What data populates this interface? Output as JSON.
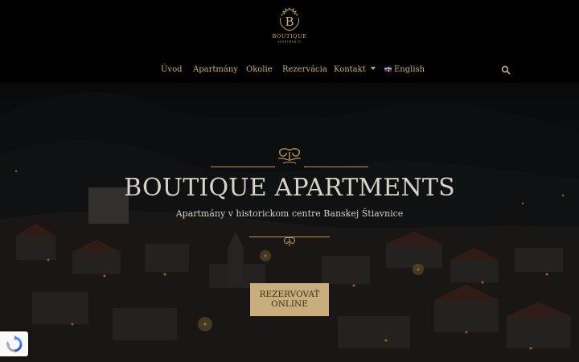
{
  "logo": {
    "letter": "B",
    "name": "BOUTIQUE",
    "tagline": "APARTMENTS"
  },
  "nav": {
    "items": [
      {
        "label": "Úvod"
      },
      {
        "label": "Apartmány"
      },
      {
        "label": "Okolie"
      },
      {
        "label": "Rezervácia"
      },
      {
        "label": "Kontakt",
        "has_dropdown": true
      },
      {
        "label": "English",
        "flag": "uk-flag"
      }
    ],
    "search_icon": "search-icon"
  },
  "hero": {
    "title": "BOUTIQUE APARTMENTS",
    "subtitle": "Apartmány v historickom centre Banskej Štiavnice",
    "cta_line1": "REZERVOVAŤ",
    "cta_line2": "ONLINE"
  },
  "recaptcha": {
    "icon": "recaptcha-icon"
  },
  "colors": {
    "accent": "#c9b07a",
    "cta_bg": "#c8ae7c",
    "header_bg": "#000000"
  }
}
